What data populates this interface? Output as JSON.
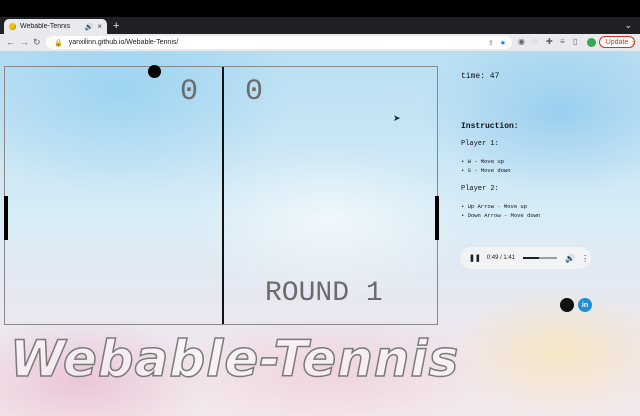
{
  "browser": {
    "tab_title": "Webable-Tennis",
    "tab_close": "×",
    "new_tab": "+",
    "tab_menu": "⌄",
    "url": "yanxilinn.github.io/Webable-Tennis/",
    "update_label": "Update"
  },
  "game": {
    "score_left": "0",
    "score_right": "0",
    "round_label": "ROUND 1"
  },
  "sidebar": {
    "time_label": "time: 47",
    "instruction_title": "Instruction:",
    "player1_title": "Player 1:",
    "player1_controls": [
      "W - Move up",
      "S - Move down"
    ],
    "player2_title": "Player 2:",
    "player2_controls": [
      "Up Arrow - Move up",
      "Down Arrow - Move down"
    ]
  },
  "audio": {
    "time": "0:49 / 1:41",
    "progress": 0.48
  },
  "social": {
    "linkedin_text": "in"
  },
  "brand_text": "Webable-Tennis"
}
